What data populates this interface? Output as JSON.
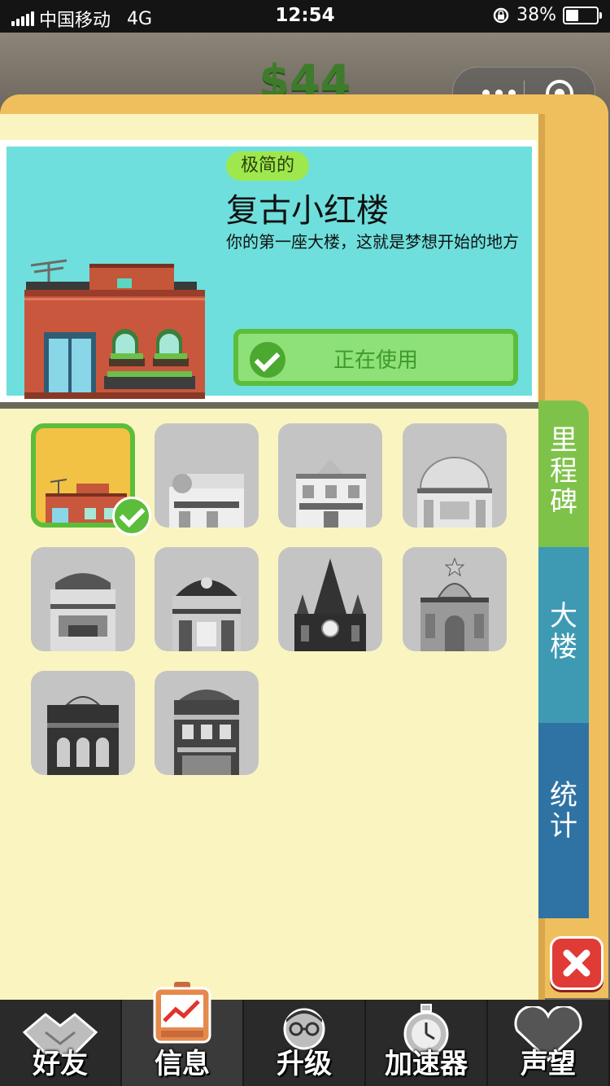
{
  "status_bar": {
    "carrier": "中国移动",
    "network": "4G",
    "time": "12:54",
    "battery_percent": "38%"
  },
  "game": {
    "money": "$44"
  },
  "featured": {
    "tag": "极简的",
    "title": "复古小红楼",
    "description": "你的第一座大楼，这就是梦想开始的地方",
    "status_button": "正在使用"
  },
  "buildings": [
    {
      "name": "retro-red-building",
      "selected": true,
      "locked": false
    },
    {
      "name": "building-2",
      "selected": false,
      "locked": true
    },
    {
      "name": "building-3",
      "selected": false,
      "locked": true
    },
    {
      "name": "building-4",
      "selected": false,
      "locked": true
    },
    {
      "name": "building-5",
      "selected": false,
      "locked": true
    },
    {
      "name": "building-6",
      "selected": false,
      "locked": true
    },
    {
      "name": "building-7",
      "selected": false,
      "locked": true
    },
    {
      "name": "building-8",
      "selected": false,
      "locked": true
    },
    {
      "name": "building-9",
      "selected": false,
      "locked": true
    },
    {
      "name": "building-10",
      "selected": false,
      "locked": true
    }
  ],
  "side_tabs": {
    "milestone": "里程碑",
    "building": "大楼",
    "stats": "统计"
  },
  "bottom_nav": [
    {
      "label": "好友",
      "icon": "handshake-icon"
    },
    {
      "label": "信息",
      "icon": "info-chart-icon"
    },
    {
      "label": "升级",
      "icon": "upgrade-person-icon"
    },
    {
      "label": "加速器",
      "icon": "stopwatch-icon"
    },
    {
      "label": "声望",
      "icon": "heart-icon"
    }
  ],
  "colors": {
    "panel": "#faf5c0",
    "accent_green": "#5cbd3a",
    "card_bg": "#6edfdc",
    "close_red": "#e03b36"
  }
}
